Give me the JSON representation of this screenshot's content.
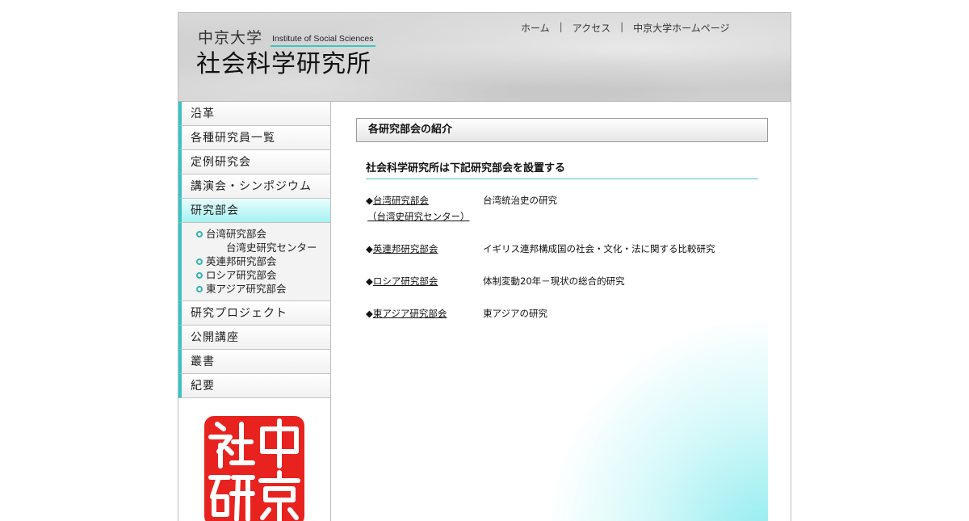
{
  "header": {
    "univ": "中京大学",
    "institute_en": "Institute of Social Sciences",
    "institute_jp": "社会科学研究所",
    "topnav": [
      "ホーム",
      "アクセス",
      "中京大学ホームページ"
    ]
  },
  "sidebar": {
    "items": [
      {
        "label": "沿革"
      },
      {
        "label": "各種研究員一覧"
      },
      {
        "label": "定例研究会"
      },
      {
        "label": "講演会・シンポジウム"
      },
      {
        "label": "研究部会"
      },
      {
        "label": "研究プロジェクト"
      },
      {
        "label": "公開講座"
      },
      {
        "label": "叢書"
      },
      {
        "label": "紀要"
      }
    ],
    "subitems": [
      {
        "label": "台湾研究部会",
        "sub": "台湾史研究センター"
      },
      {
        "label": "英連邦研究部会"
      },
      {
        "label": "ロシア研究部会"
      },
      {
        "label": "東アジア研究部会"
      }
    ],
    "seal_text": "中京社研"
  },
  "content": {
    "section_title": "各研究部会の紹介",
    "subheading": "社会科学研究所は下記研究部会を設置する",
    "rows": [
      {
        "bullet": "◆",
        "name": "台湾研究部会",
        "sub": "（台湾史研究センター）",
        "desc": "台湾統治史の研究"
      },
      {
        "bullet": "◆",
        "name": "英連邦研究部会",
        "desc": "イギリス連邦構成国の社会・文化・法に関する比較研究"
      },
      {
        "bullet": "◆",
        "name": "ロシア研究部会",
        "desc": "体制変動20年－現状の総合的研究"
      },
      {
        "bullet": "◆",
        "name": "東アジア研究部会",
        "desc": "東アジアの研究"
      }
    ]
  },
  "colors": {
    "accent": "#39c3c3",
    "active_nav": "#a7f2f2",
    "seal_red": "#e8231f"
  }
}
